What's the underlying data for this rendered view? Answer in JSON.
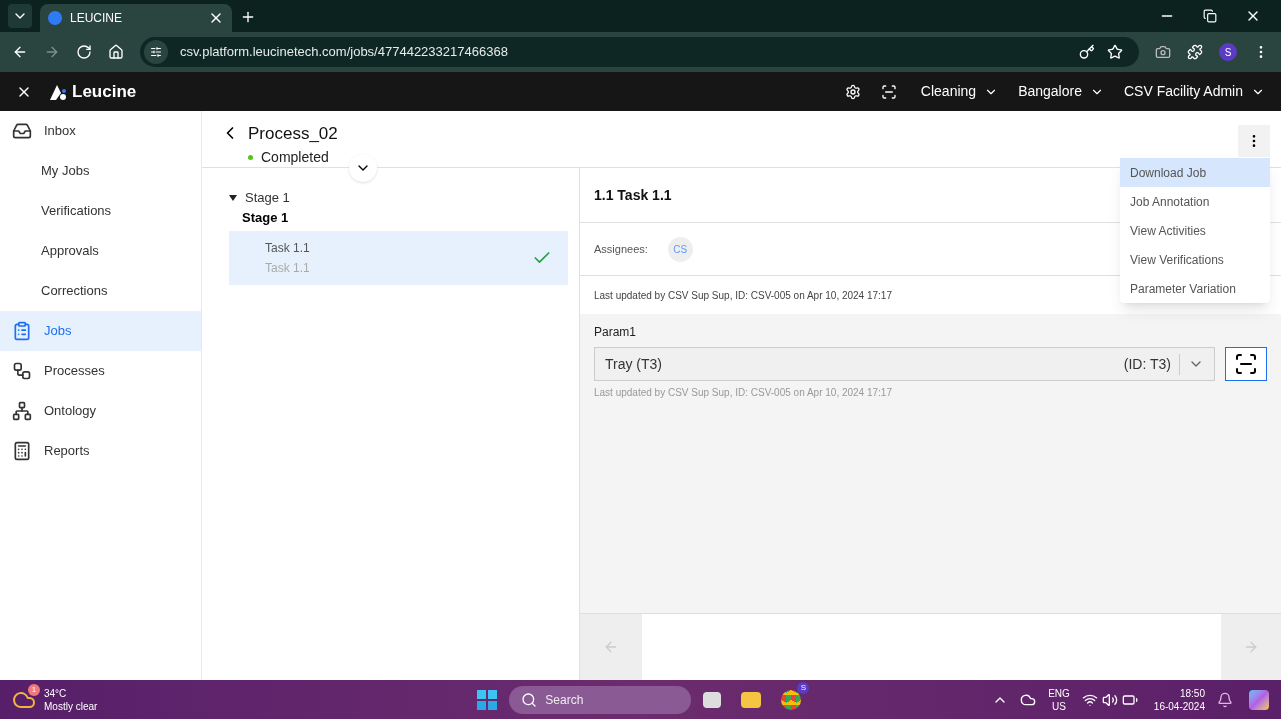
{
  "browser": {
    "tab_title": "LEUCINE",
    "url": "csv.platform.leucinetech.com/jobs/477442233217466368",
    "profile_initial": "S"
  },
  "header": {
    "brand": "Leucine",
    "dropdowns": [
      "Cleaning",
      "Bangalore",
      "CSV Facility Admin"
    ]
  },
  "sidebar": {
    "items": [
      {
        "label": "Inbox",
        "selected": false,
        "children": [
          {
            "label": "My Jobs",
            "selected": false
          },
          {
            "label": "Verifications",
            "selected": false
          },
          {
            "label": "Approvals",
            "selected": false
          },
          {
            "label": "Corrections",
            "selected": false
          }
        ]
      },
      {
        "label": "Jobs",
        "selected": true
      },
      {
        "label": "Processes",
        "selected": false
      },
      {
        "label": "Ontology",
        "selected": false
      },
      {
        "label": "Reports",
        "selected": false
      }
    ]
  },
  "job": {
    "title": "Process_02",
    "status": {
      "label": "Completed",
      "color": "#52c41a"
    }
  },
  "stages": [
    {
      "label": "Stage 1",
      "name": "Stage 1",
      "expanded": true,
      "tasks": [
        {
          "title": "Task 1.1",
          "subtitle": "Task 1.1",
          "selected": true,
          "completed": true
        }
      ]
    }
  ],
  "task": {
    "heading": "1.1 Task 1.1",
    "assignees_label": "Assignees:",
    "assignees": [
      "CS"
    ],
    "last_updated": "Last updated by CSV Sup Sup, ID: CSV-005 on Apr 10, 2024 17:17",
    "parameters": [
      {
        "label": "Param1",
        "value": "Tray (T3)",
        "id": "(ID: T3)",
        "last_updated": "Last updated by CSV Sup Sup, ID: CSV-005 on Apr 10, 2024 17:17"
      }
    ]
  },
  "menu": {
    "items": [
      {
        "label": "Download Job",
        "selected": true
      },
      {
        "label": "Job Annotation",
        "selected": false
      },
      {
        "label": "View Activities",
        "selected": false
      },
      {
        "label": "View Verifications",
        "selected": false
      },
      {
        "label": "Parameter Variation",
        "selected": false
      }
    ]
  },
  "footer": {
    "prev_disabled": true,
    "next_disabled": true
  },
  "taskbar": {
    "temperature": "34°C",
    "weather": "Mostly clear",
    "weather_badge": "1",
    "search_placeholder": "Search",
    "chrome_badge": "S",
    "language": "ENG",
    "region": "US",
    "time": "18:50",
    "date": "16-04-2024"
  }
}
